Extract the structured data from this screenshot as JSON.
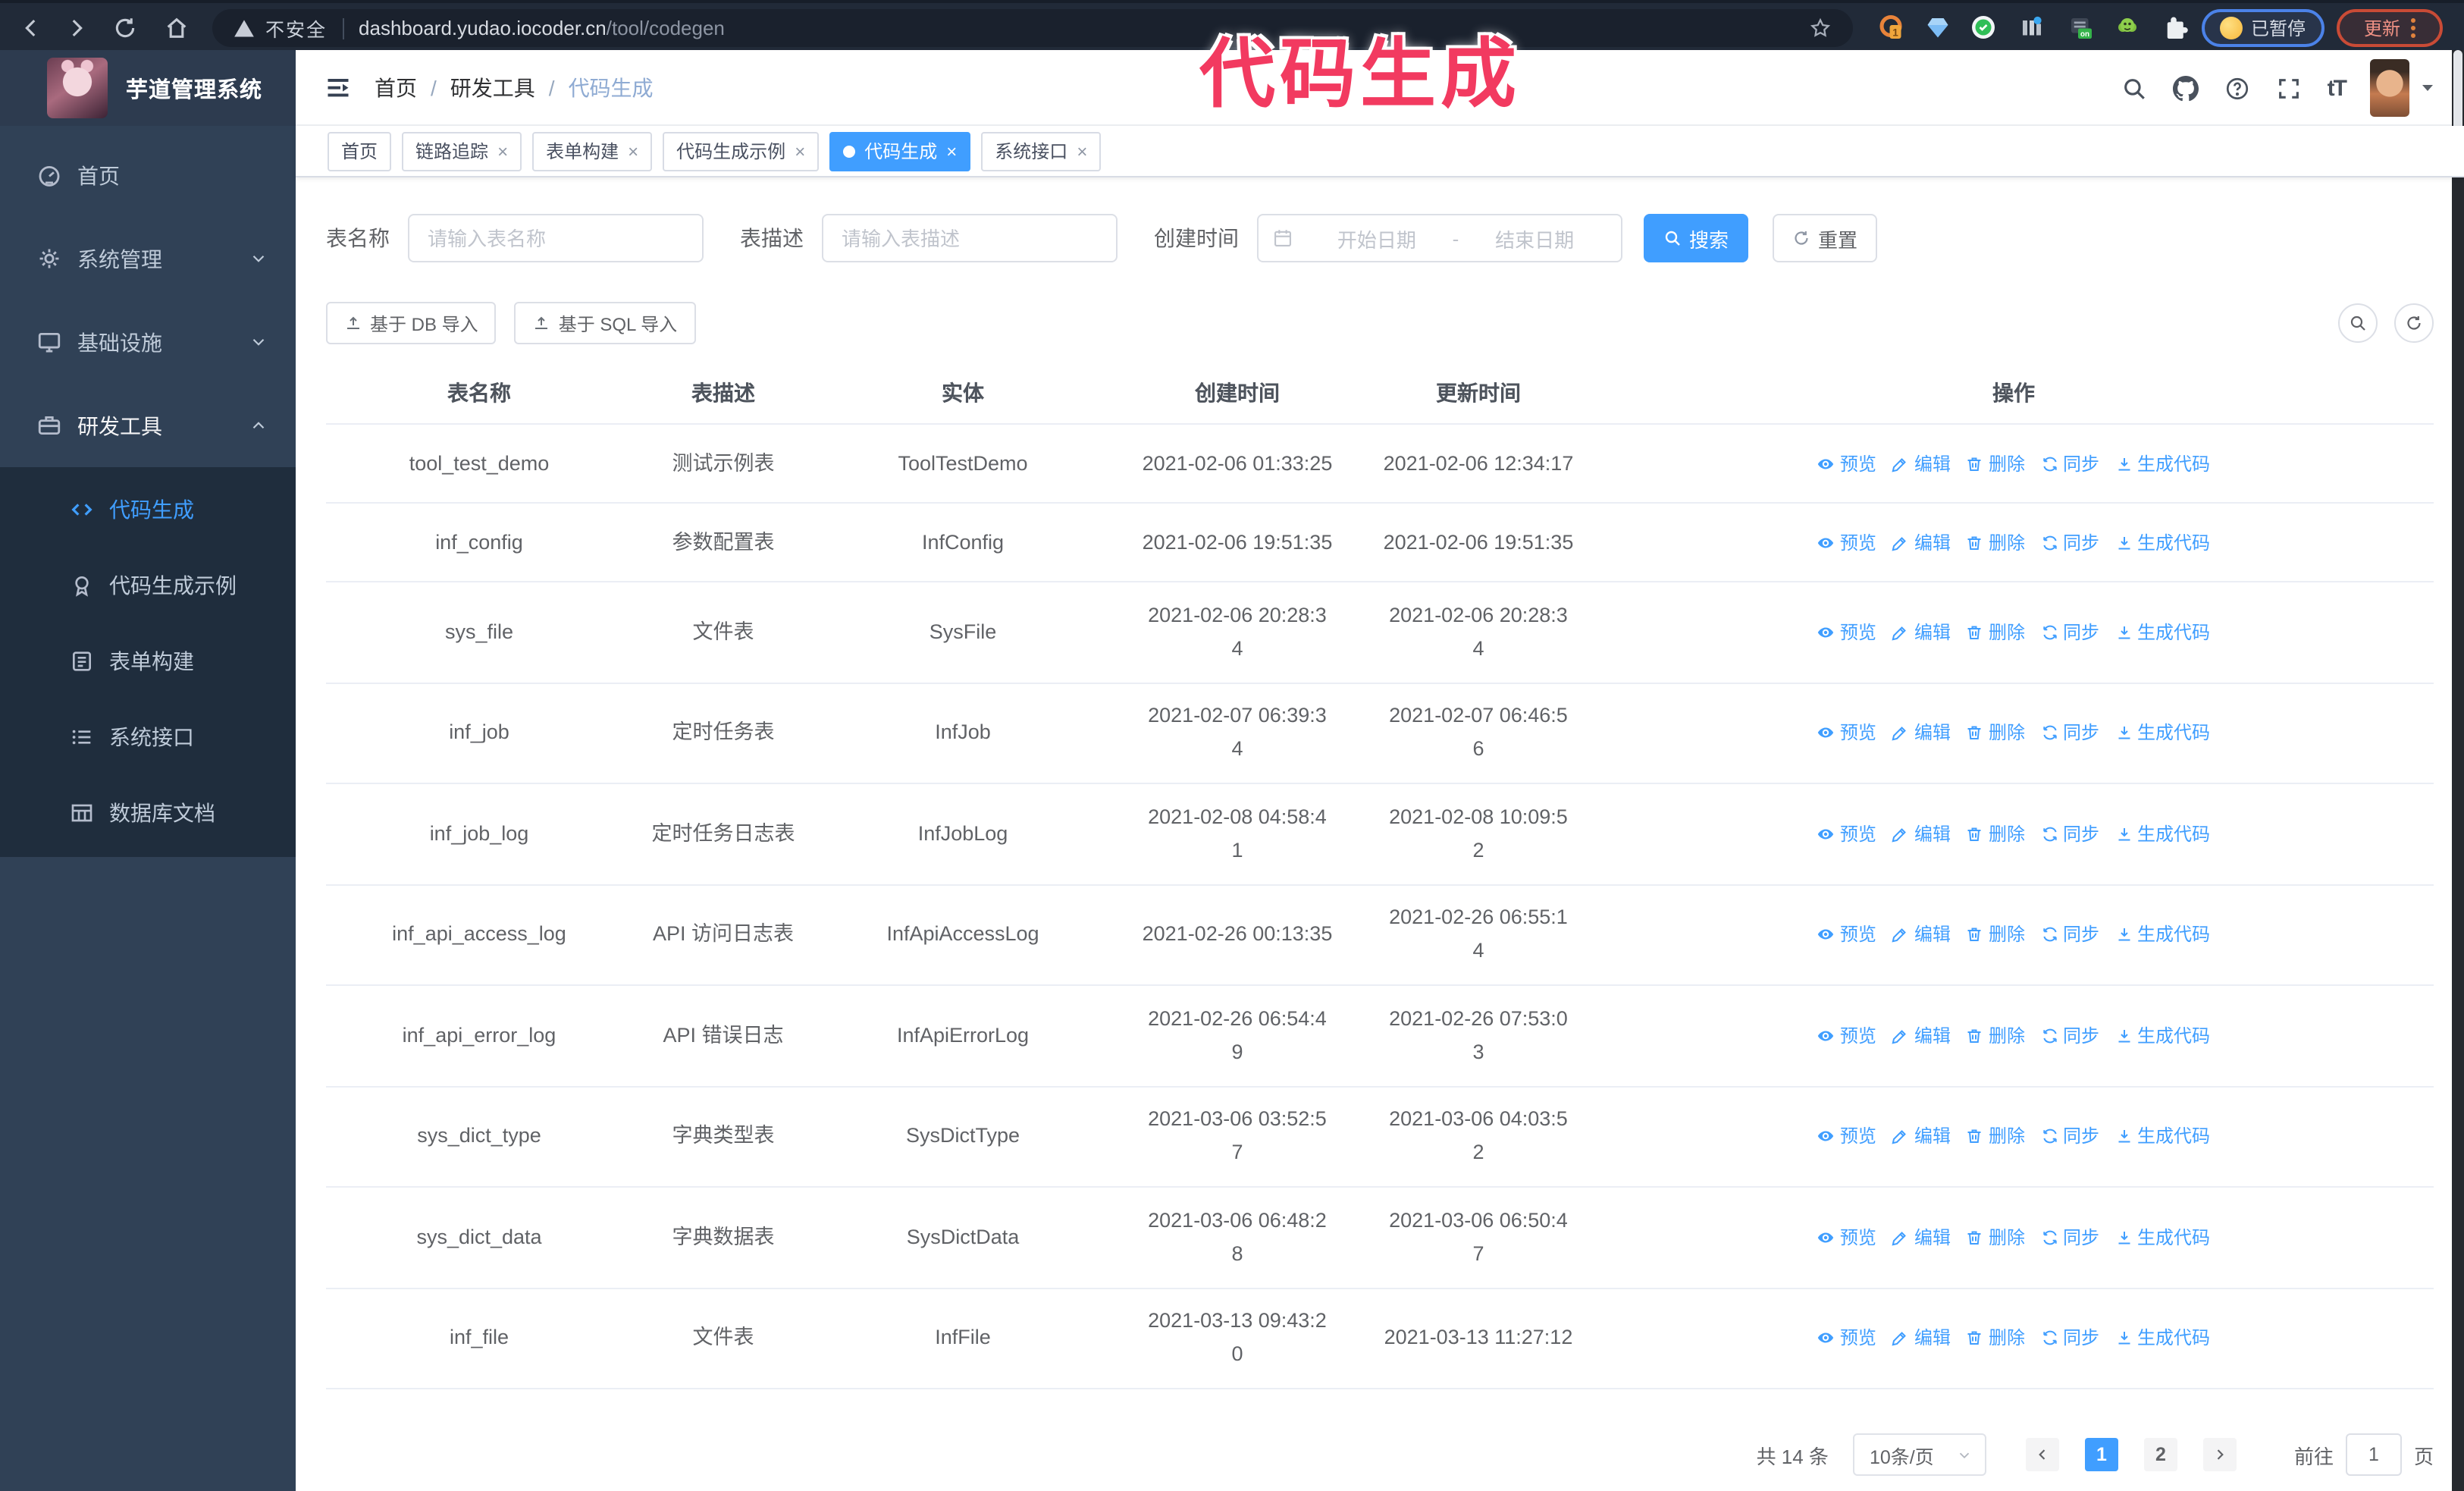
{
  "chrome": {
    "security_label": "不安全",
    "url_host": "dashboard.yudao.iocoder.cn",
    "url_path": "/tool/codegen",
    "extension_badge": "1",
    "extension_on_badge": "on",
    "paused_label": "已暂停",
    "update_label": "更新"
  },
  "annotation": {
    "text": "代码生成",
    "color": "#f23a60"
  },
  "sidebar": {
    "title": "芋道管理系统",
    "items": [
      {
        "label": "首页",
        "icon": "gauge-icon",
        "arrow": ""
      },
      {
        "label": "系统管理",
        "icon": "gear-icon",
        "arrow": "down"
      },
      {
        "label": "基础设施",
        "icon": "monitor-icon",
        "arrow": "down"
      },
      {
        "label": "研发工具",
        "icon": "suitcase-icon",
        "arrow": "up",
        "active": true
      }
    ],
    "subitems": [
      {
        "label": "代码生成",
        "icon": "code-icon",
        "active": true
      },
      {
        "label": "代码生成示例",
        "icon": "badge-icon"
      },
      {
        "label": "表单构建",
        "icon": "form-icon"
      },
      {
        "label": "系统接口",
        "icon": "api-icon"
      },
      {
        "label": "数据库文档",
        "icon": "dbtable-icon"
      }
    ]
  },
  "navbar": {
    "breadcrumb": [
      "首页",
      "研发工具",
      "代码生成"
    ]
  },
  "tabs": [
    {
      "label": "首页",
      "closable": false,
      "active": false
    },
    {
      "label": "链路追踪",
      "closable": true,
      "active": false
    },
    {
      "label": "表单构建",
      "closable": true,
      "active": false
    },
    {
      "label": "代码生成示例",
      "closable": true,
      "active": false
    },
    {
      "label": "代码生成",
      "closable": true,
      "active": true
    },
    {
      "label": "系统接口",
      "closable": true,
      "active": false
    }
  ],
  "filters": {
    "name_label": "表名称",
    "name_placeholder": "请输入表名称",
    "desc_label": "表描述",
    "desc_placeholder": "请输入表描述",
    "time_label": "创建时间",
    "start_placeholder": "开始日期",
    "range_separator": "-",
    "end_placeholder": "结束日期",
    "search_label": "搜索",
    "reset_label": "重置"
  },
  "toolbar": {
    "import_db_label": "基于 DB 导入",
    "import_sql_label": "基于 SQL 导入"
  },
  "table": {
    "columns": [
      "表名称",
      "表描述",
      "实体",
      "创建时间",
      "更新时间",
      "操作"
    ],
    "action_labels": [
      "预览",
      "编辑",
      "删除",
      "同步",
      "生成代码"
    ],
    "action_icons": [
      "eye-icon",
      "edit-icon",
      "delete-icon",
      "sync-icon",
      "download-icon"
    ],
    "rows": [
      {
        "name": "tool_test_demo",
        "desc": "测试示例表",
        "entity": "ToolTestDemo",
        "create": "2021-02-06 01:33:25",
        "create_wrap": false,
        "update": "2021-02-06 12:34:17",
        "update_wrap": false
      },
      {
        "name": "inf_config",
        "desc": "参数配置表",
        "entity": "InfConfig",
        "create": "2021-02-06 19:51:35",
        "create_wrap": false,
        "update": "2021-02-06 19:51:35",
        "update_wrap": false
      },
      {
        "name": "sys_file",
        "desc": "文件表",
        "entity": "SysFile",
        "create": "2021-02-06 20:28:34",
        "create_wrap": true,
        "update": "2021-02-06 20:28:34",
        "update_wrap": true
      },
      {
        "name": "inf_job",
        "desc": "定时任务表",
        "entity": "InfJob",
        "create": "2021-02-07 06:39:34",
        "create_wrap": true,
        "update": "2021-02-07 06:46:56",
        "update_wrap": true
      },
      {
        "name": "inf_job_log",
        "desc": "定时任务日志表",
        "entity": "InfJobLog",
        "create": "2021-02-08 04:58:41",
        "create_wrap": true,
        "update": "2021-02-08 10:09:52",
        "update_wrap": true
      },
      {
        "name": "inf_api_access_log",
        "desc": "API 访问日志表",
        "entity": "InfApiAccessLog",
        "create": "2021-02-26 00:13:35",
        "create_wrap": false,
        "update": "2021-02-26 06:55:14",
        "update_wrap": true
      },
      {
        "name": "inf_api_error_log",
        "desc": "API 错误日志",
        "entity": "InfApiErrorLog",
        "create": "2021-02-26 06:54:49",
        "create_wrap": true,
        "update": "2021-02-26 07:53:03",
        "update_wrap": true
      },
      {
        "name": "sys_dict_type",
        "desc": "字典类型表",
        "entity": "SysDictType",
        "create": "2021-03-06 03:52:57",
        "create_wrap": true,
        "update": "2021-03-06 04:03:52",
        "update_wrap": true
      },
      {
        "name": "sys_dict_data",
        "desc": "字典数据表",
        "entity": "SysDictData",
        "create": "2021-03-06 06:48:28",
        "create_wrap": true,
        "update": "2021-03-06 06:50:47",
        "update_wrap": true
      },
      {
        "name": "inf_file",
        "desc": "文件表",
        "entity": "InfFile",
        "create": "2021-03-13 09:43:20",
        "create_wrap": true,
        "update": "2021-03-13 11:27:12",
        "update_wrap": false
      }
    ]
  },
  "pagination": {
    "total": "共 14 条",
    "page_size": "10条/页",
    "pages": [
      "1",
      "2"
    ],
    "active_page": "1",
    "goto_label": "前往",
    "goto_value": "1",
    "page_label": "页"
  }
}
